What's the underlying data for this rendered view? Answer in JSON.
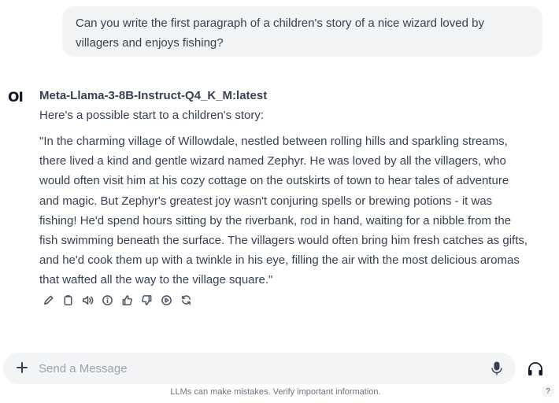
{
  "user_message": "Can you write the first paragraph of a children's story of a nice wizard loved by villagers and enjoys fishing?",
  "assistant": {
    "avatar_text": "OI",
    "model_name": "Meta-Llama-3-8B-Instruct-Q4_K_M:latest",
    "intro": "Here's a possible start to a children's story:",
    "story": "\"In the charming village of Willowdale, nestled between rolling hills and sparkling streams, there lived a kind and gentle wizard named Zephyr. He was loved by all the villagers, who would often visit him at his cozy cottage on the outskirts of town to hear tales of adventure and magic. But Zephyr's greatest joy wasn't conjuring spells or brewing potions - it was fishing! He'd spend hours sitting by the riverbank, rod in hand, waiting for a nibble from the fish swimming beneath the surface. The villagers would often bring him fresh catches as gifts, and he'd cook them up with a twinkle in his eye, filling the air with the most delicious aromas that wafted all the way to the village square.\"",
    "action_icons": [
      "edit-icon",
      "copy-icon",
      "read-aloud-icon",
      "info-icon",
      "thumbs-up-icon",
      "thumbs-down-icon",
      "continue-icon",
      "regenerate-icon"
    ]
  },
  "composer": {
    "placeholder": "Send a Message",
    "icons": [
      "plus-icon",
      "microphone-icon",
      "headphones-icon"
    ]
  },
  "footer": {
    "disclaimer": "LLMs can make mistakes. Verify important information.",
    "help_label": "?"
  }
}
